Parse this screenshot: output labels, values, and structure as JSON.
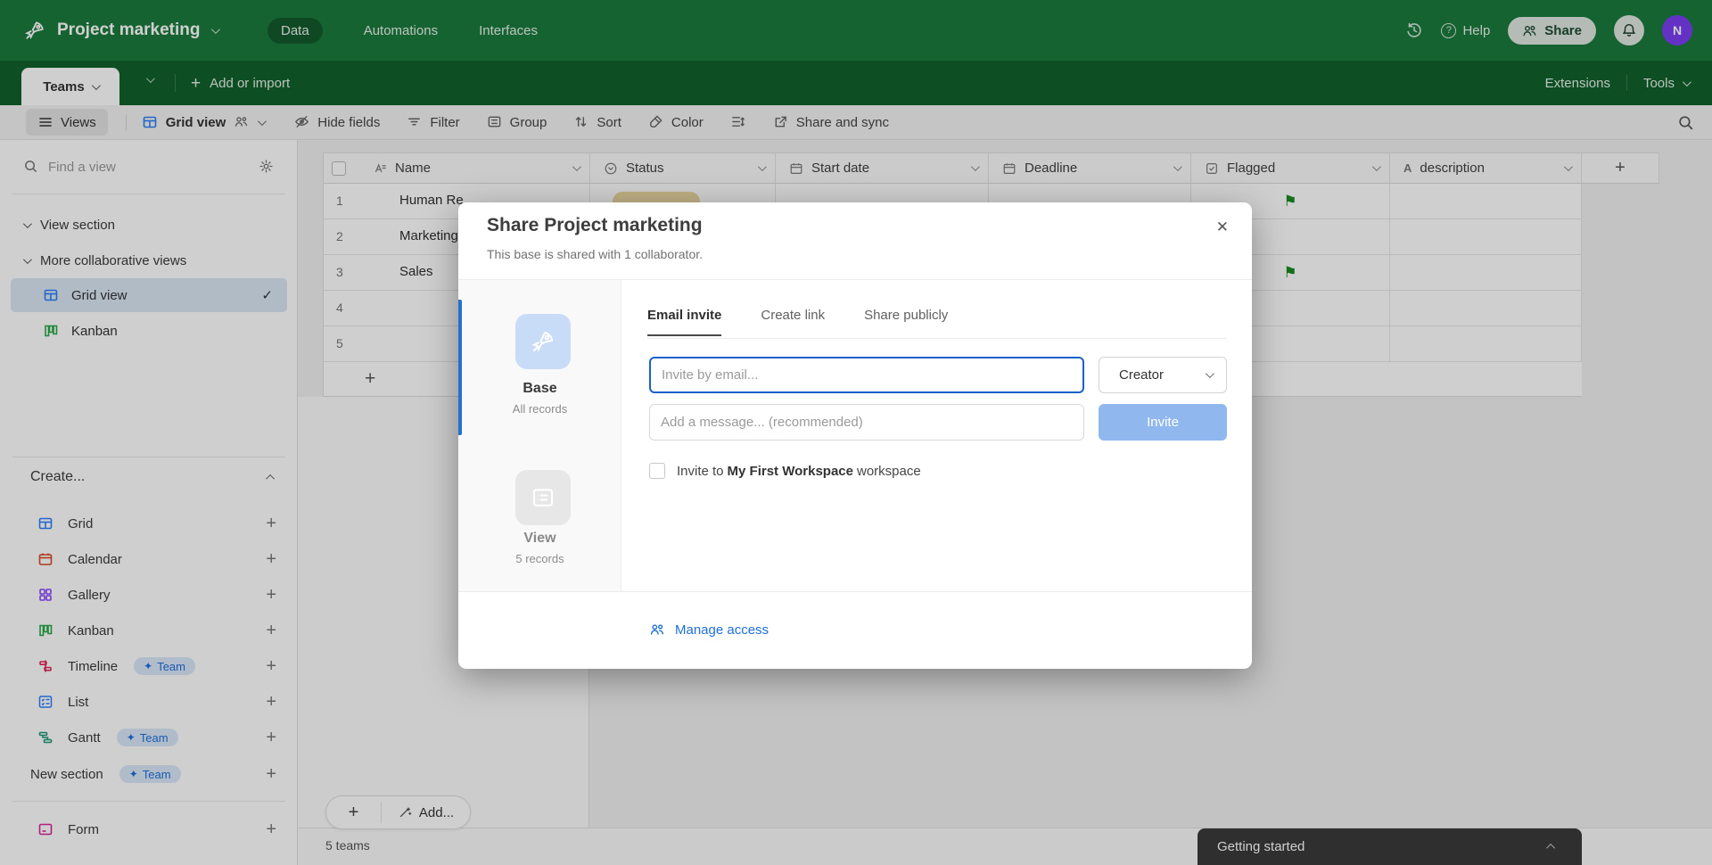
{
  "topbar": {
    "title": "Project marketing",
    "tabs": {
      "data": "Data",
      "automations": "Automations",
      "interfaces": "Interfaces"
    },
    "help_label": "Help",
    "share_label": "Share",
    "avatar_initial": "N"
  },
  "tabbar": {
    "table_tab": "Teams",
    "add_or_import": "Add or import",
    "extensions": "Extensions",
    "tools": "Tools"
  },
  "toolbar": {
    "views": "Views",
    "grid_view": "Grid view",
    "hide_fields": "Hide fields",
    "filter": "Filter",
    "group": "Group",
    "sort": "Sort",
    "color": "Color",
    "share_and_sync": "Share and sync"
  },
  "sidebar": {
    "find_placeholder": "Find a view",
    "section1": "View section",
    "section2": "More collaborative views",
    "grid_view": "Grid view",
    "kanban": "Kanban",
    "create_header": "Create...",
    "items": {
      "grid": "Grid",
      "calendar": "Calendar",
      "gallery": "Gallery",
      "kanban": "Kanban",
      "timeline": "Timeline",
      "list": "List",
      "gantt": "Gantt",
      "new_section": "New section",
      "form": "Form"
    },
    "team_badge": "Team"
  },
  "table": {
    "columns": {
      "name": "Name",
      "status": "Status",
      "start_date": "Start date",
      "deadline": "Deadline",
      "flagged": "Flagged",
      "description": "description"
    },
    "rows": [
      {
        "num": "1",
        "name": "Human Re",
        "flagged": true,
        "status_pill": true
      },
      {
        "num": "2",
        "name": "Marketing",
        "flagged": false,
        "status_pill": false
      },
      {
        "num": "3",
        "name": "Sales",
        "flagged": true,
        "status_pill": false
      },
      {
        "num": "4",
        "name": "",
        "flagged": false,
        "status_pill": false
      },
      {
        "num": "5",
        "name": "",
        "flagged": false,
        "status_pill": false
      }
    ],
    "add_button": "Add...",
    "footer_count": "5 teams"
  },
  "modal": {
    "title": "Share Project marketing",
    "subtitle": "This base is shared with 1 collaborator.",
    "tab_email": "Email invite",
    "tab_link": "Create link",
    "tab_public": "Share publicly",
    "base_label": "Base",
    "base_sublabel": "All records",
    "view_label": "View",
    "view_sublabel": "5 records",
    "email_placeholder": "Invite by email...",
    "permission_value": "Creator",
    "message_placeholder": "Add a message... (recommended)",
    "invite_label": "Invite",
    "checkbox_prefix": "Invite to",
    "workspace_name": "My First Workspace",
    "checkbox_suffix": "workspace",
    "manage_access": "Manage access"
  },
  "getting_started": "Getting started",
  "colors": {
    "topbar_green": "#1a7a3c",
    "tabbar_green": "#11602c",
    "accent_blue": "#2d7ff9",
    "selected_view_bg": "#d9e7f4",
    "status_pill": "#ecd9a2",
    "flag_green": "#178a1f",
    "invite_button": "#90b7ee",
    "avatar_purple": "#7a3df0"
  }
}
